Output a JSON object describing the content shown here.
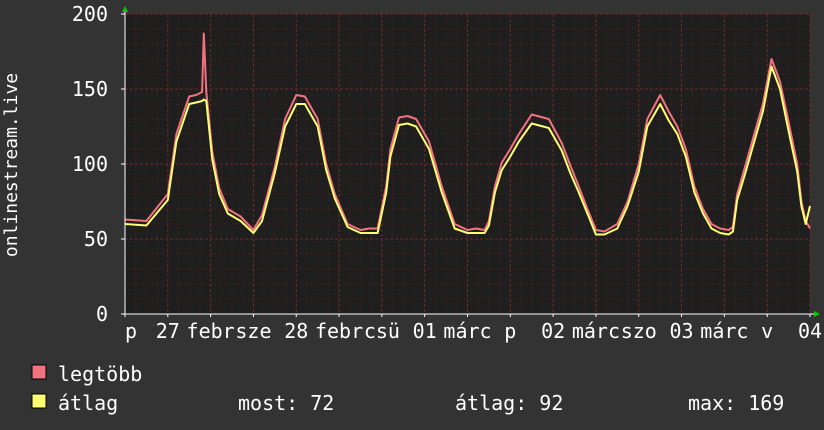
{
  "colors": {
    "background": "#333333",
    "plot_background": "#1e1e1e",
    "grid": "#7a2a2a",
    "axis": "#ffffff",
    "series_max": "#f27380",
    "series_avg": "#ffff73",
    "axis_arrow": "#00cc00"
  },
  "legend": {
    "max_label": "legtöbb",
    "avg_label": "átlag"
  },
  "stats": {
    "current": "most: 72",
    "average": "átlag: 92",
    "maximum": "max: 169"
  },
  "chart_data": {
    "type": "line",
    "ylabel": "onlinestream.live",
    "xlabel": "",
    "title": "",
    "ylim": [
      0,
      200
    ],
    "y_ticks": [
      0,
      50,
      100,
      150,
      200
    ],
    "x_range": [
      0,
      8
    ],
    "x_ticks": [
      {
        "pos": 0.0,
        "label": "p"
      },
      {
        "pos": 0.5,
        "label": "27"
      },
      {
        "pos": 1.0,
        "label": "febr"
      },
      {
        "pos": 1.5,
        "label": "sze"
      },
      {
        "pos": 2.0,
        "label": "28"
      },
      {
        "pos": 2.5,
        "label": "febr"
      },
      {
        "pos": 3.0,
        "label": "csü"
      },
      {
        "pos": 3.5,
        "label": "01"
      },
      {
        "pos": 4.0,
        "label": "márc"
      },
      {
        "pos": 4.5,
        "label": "p"
      },
      {
        "pos": 5.0,
        "label": "02"
      },
      {
        "pos": 5.5,
        "label": "márc"
      },
      {
        "pos": 6.0,
        "label": "szo"
      },
      {
        "pos": 6.5,
        "label": "03"
      },
      {
        "pos": 7.0,
        "label": "márc"
      },
      {
        "pos": 7.5,
        "label": "v"
      },
      {
        "pos": 8.0,
        "label": "04"
      }
    ],
    "series": [
      {
        "name": "legtöbb",
        "x": [
          0.0,
          0.25,
          0.5,
          0.6,
          0.75,
          0.83,
          0.9,
          0.92,
          0.95,
          1.02,
          1.1,
          1.2,
          1.35,
          1.5,
          1.6,
          1.75,
          1.87,
          2.0,
          2.1,
          2.25,
          2.35,
          2.45,
          2.6,
          2.75,
          2.85,
          2.95,
          3.05,
          3.1,
          3.2,
          3.3,
          3.4,
          3.55,
          3.7,
          3.85,
          4.0,
          4.1,
          4.2,
          4.25,
          4.32,
          4.4,
          4.5,
          4.6,
          4.75,
          4.95,
          5.1,
          5.2,
          5.3,
          5.4,
          5.5,
          5.6,
          5.75,
          5.87,
          6.0,
          6.1,
          6.25,
          6.35,
          6.45,
          6.55,
          6.65,
          6.75,
          6.85,
          6.95,
          7.05,
          7.1,
          7.15,
          7.25,
          7.35,
          7.45,
          7.55,
          7.65,
          7.75,
          7.85,
          7.9,
          7.95,
          8.0
        ],
        "values": [
          63,
          62,
          80,
          120,
          145,
          146,
          148,
          187,
          148,
          108,
          84,
          70,
          65,
          56,
          66,
          98,
          130,
          146,
          145,
          130,
          100,
          80,
          60,
          56,
          57,
          57,
          85,
          110,
          131,
          132,
          130,
          115,
          85,
          60,
          56,
          57,
          56,
          62,
          85,
          101,
          110,
          120,
          133,
          130,
          114,
          99,
          85,
          70,
          56,
          55,
          60,
          75,
          100,
          130,
          146,
          135,
          125,
          110,
          85,
          70,
          60,
          57,
          56,
          58,
          80,
          100,
          120,
          140,
          170,
          155,
          128,
          100,
          75,
          62,
          57
        ]
      },
      {
        "name": "átlag",
        "x": [
          0.0,
          0.25,
          0.5,
          0.6,
          0.75,
          0.83,
          0.9,
          0.92,
          0.95,
          1.02,
          1.1,
          1.2,
          1.35,
          1.5,
          1.6,
          1.75,
          1.87,
          2.0,
          2.1,
          2.25,
          2.35,
          2.45,
          2.6,
          2.75,
          2.85,
          2.95,
          3.05,
          3.1,
          3.2,
          3.3,
          3.4,
          3.55,
          3.7,
          3.85,
          4.0,
          4.1,
          4.2,
          4.25,
          4.32,
          4.4,
          4.5,
          4.6,
          4.75,
          4.95,
          5.1,
          5.2,
          5.3,
          5.4,
          5.5,
          5.6,
          5.75,
          5.87,
          6.0,
          6.1,
          6.25,
          6.35,
          6.45,
          6.55,
          6.65,
          6.75,
          6.85,
          6.95,
          7.05,
          7.1,
          7.15,
          7.25,
          7.35,
          7.45,
          7.55,
          7.65,
          7.75,
          7.85,
          7.9,
          7.95,
          8.0
        ],
        "values": [
          60,
          59,
          76,
          115,
          140,
          141,
          142,
          143,
          142,
          103,
          80,
          67,
          62,
          54,
          62,
          94,
          125,
          140,
          140,
          125,
          96,
          77,
          58,
          54,
          54,
          54,
          81,
          105,
          126,
          127,
          125,
          110,
          81,
          57,
          54,
          54,
          54,
          59,
          81,
          96,
          105,
          115,
          127,
          124,
          109,
          94,
          81,
          67,
          53,
          53,
          57,
          72,
          95,
          125,
          140,
          129,
          120,
          105,
          81,
          67,
          57,
          54,
          53,
          55,
          76,
          95,
          115,
          135,
          165,
          150,
          122,
          95,
          72,
          60,
          72
        ]
      }
    ],
    "legend_position": "bottom-left",
    "grid": true
  }
}
